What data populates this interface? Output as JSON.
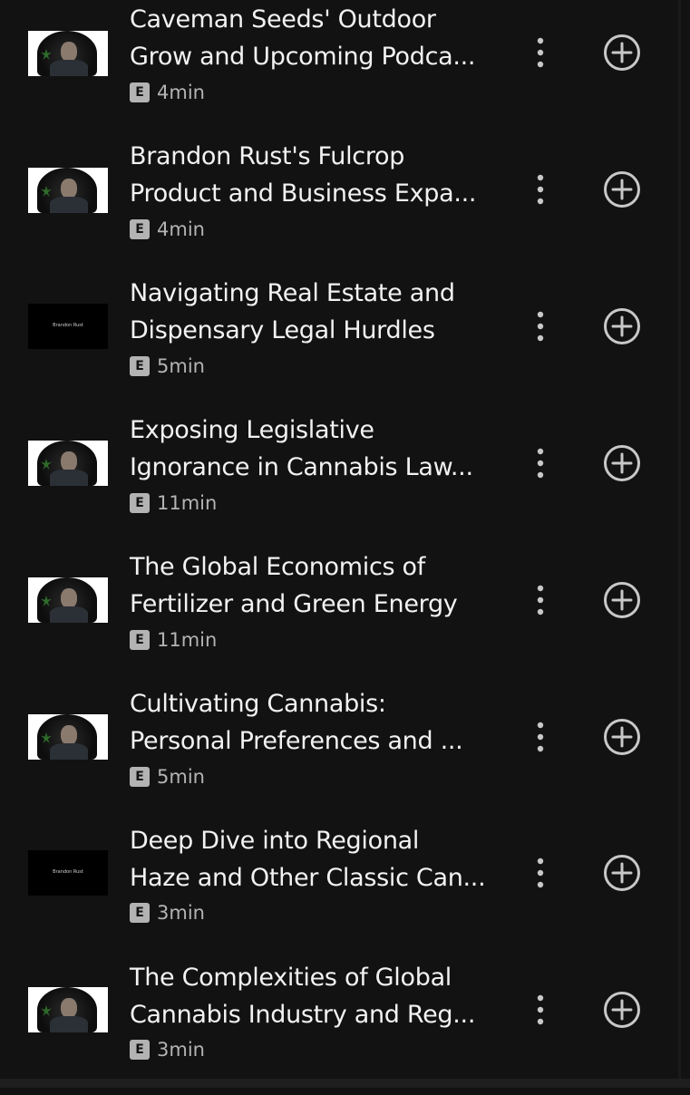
{
  "episodes": [
    {
      "title": "Caveman Seeds' Outdoor\nGrow and Upcoming Podca...",
      "explicit": "E",
      "duration": "4min",
      "thumb": "video"
    },
    {
      "title": "Brandon Rust's Fulcrop\nProduct and Business Expa...",
      "explicit": "E",
      "duration": "4min",
      "thumb": "video"
    },
    {
      "title": "Navigating Real Estate and\nDispensary Legal Hurdles",
      "explicit": "E",
      "duration": "5min",
      "thumb": "title-card",
      "thumb_caption": "Brandon Rust"
    },
    {
      "title": "Exposing Legislative\nIgnorance in Cannabis Law...",
      "explicit": "E",
      "duration": "11min",
      "thumb": "video"
    },
    {
      "title": "The Global Economics of\nFertilizer and Green Energy",
      "explicit": "E",
      "duration": "11min",
      "thumb": "video"
    },
    {
      "title": "Cultivating Cannabis:\nPersonal Preferences and ...",
      "explicit": "E",
      "duration": "5min",
      "thumb": "video"
    },
    {
      "title": "Deep Dive into Regional\nHaze and Other Classic Can...",
      "explicit": "E",
      "duration": "3min",
      "thumb": "title-card",
      "thumb_caption": "Brandon Rust"
    },
    {
      "title": "The Complexities of Global\nCannabis Industry and Reg...",
      "explicit": "E",
      "duration": "3min",
      "thumb": "video"
    }
  ],
  "icons": {
    "more": "more-options-icon",
    "add": "add-circle-icon"
  },
  "colors": {
    "background": "#121212",
    "title_text": "#f2f2f2",
    "secondary_text": "#b3b3b3",
    "icon": "#c8c8c8"
  }
}
